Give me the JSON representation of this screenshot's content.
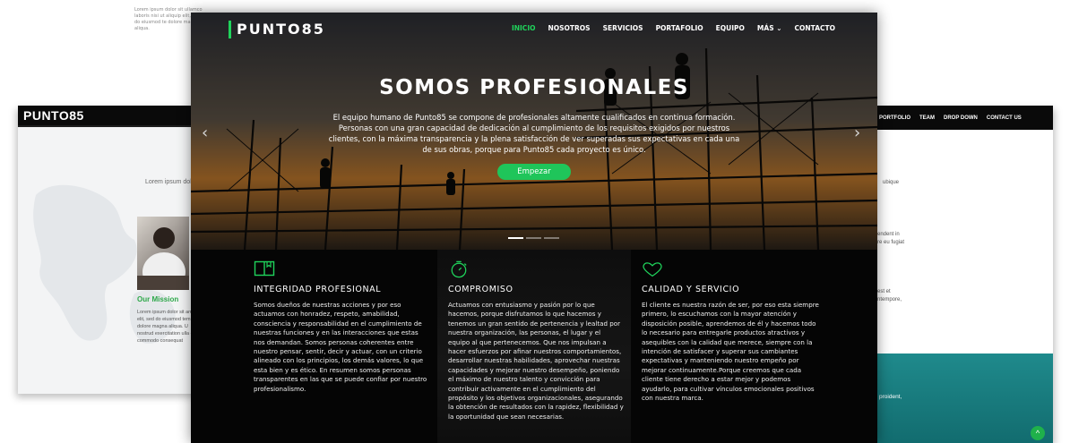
{
  "colors": {
    "accent": "#1fd35b",
    "button": "#1fc55a",
    "mission_green": "#2ea84a",
    "teal": "#1f8a8c"
  },
  "left_site": {
    "logo": "PUNTO85",
    "top_text": "Lorem ipsum dolor sit ullamco laboris nisi ut aliquip elit, sed do eiusmod te dolore magna aliqua.",
    "lorem_title": "Lorem ipsum dolor",
    "mission_title": "Our Mission",
    "mission_text": "Lorem ipsum dolor sit amet elit, sed do eiusmod tem dolore magna aliqua. U nostrud exercitation ulla ea commodo consequat"
  },
  "right_site": {
    "nav": [
      "PORTFOLIO",
      "TEAM",
      "DROP DOWN",
      "CONTACT US"
    ],
    "text1": "ubique",
    "text2": "endent in",
    "text3": "re eu fugiat",
    "text4": "est et",
    "text5": "ntempore,",
    "teal_text": "proident,",
    "scroll_icon": "chevron-up-icon"
  },
  "main_site": {
    "logo": "PUNTO85",
    "menu": [
      {
        "label": "INICIO",
        "active": true
      },
      {
        "label": "NOSOTROS"
      },
      {
        "label": "SERVICIOS"
      },
      {
        "label": "PORTAFOLIO"
      },
      {
        "label": "EQUIPO"
      },
      {
        "label": "MÁS ⌄"
      },
      {
        "label": "CONTACTO"
      }
    ],
    "hero": {
      "title": "SOMOS PROFESIONALES",
      "text": "El equipo humano de Punto85 se compone de profesionales altamente cualificados en continua formación. Personas con una gran capacidad de dedicación al cumplimiento de los requisitos exigidos por nuestros clientes, con la máxima transparencia y la plena satisfacción de ver superadas sus expectativas en cada una de sus obras, porque para Punto85 cada proyecto es único.",
      "button": "Empezar",
      "prev_icon": "chevron-left-icon",
      "next_icon": "chevron-right-icon"
    },
    "features": [
      {
        "icon": "book-icon",
        "title": "INTEGRIDAD PROFESIONAL",
        "text": "Somos dueños de nuestras acciones y por eso actuamos con honradez, respeto, amabilidad, consciencia y responsabilidad en el cumplimiento de nuestras funciones y en las interacciones que estas nos demandan. Somos personas coherentes entre nuestro pensar, sentir, decir y actuar, con un criterio alineado con los principios, los demás valores, lo que esta bien y es ético. En resumen somos personas transparentes en las que se puede confiar por nuestro profesionalismo."
      },
      {
        "icon": "stopwatch-icon",
        "title": "COMPROMISO",
        "text": "Actuamos con entusiasmo y pasión por lo que hacemos, porque disfrutamos lo que hacemos y tenemos un gran sentido de pertenencia y lealtad por nuestra organización, las personas, el lugar y el equipo al que pertenecemos. Que nos impulsan a hacer esfuerzos por afinar nuestros comportamientos, desarrollar nuestras habilidades, aprovechar nuestras capacidades y mejorar nuestro desempeño, poniendo el máximo de nuestro talento y convicción para contribuir activamente en el cumplimiento del propósito y los objetivos organizacionales, asegurando la obtención de resultados con la rapidez, flexibilidad y la oportunidad que sean necesarias."
      },
      {
        "icon": "heart-icon",
        "title": "CALIDAD Y SERVICIO",
        "text": "El cliente es nuestra razón de ser, por eso esta siempre primero, lo escuchamos con la mayor atención y disposición posible, aprendemos de él y hacemos todo lo necesario para entregarle productos atractivos y asequibles con la calidad que merece, siempre con la intención de satisfacer y superar sus cambiantes expectativas y manteniendo nuestro empeño por mejorar continuamente.Porque creemos que cada cliente tiene derecho a estar mejor y podemos ayudarlo, para cultivar vínculos emocionales positivos con nuestra marca."
      }
    ]
  }
}
